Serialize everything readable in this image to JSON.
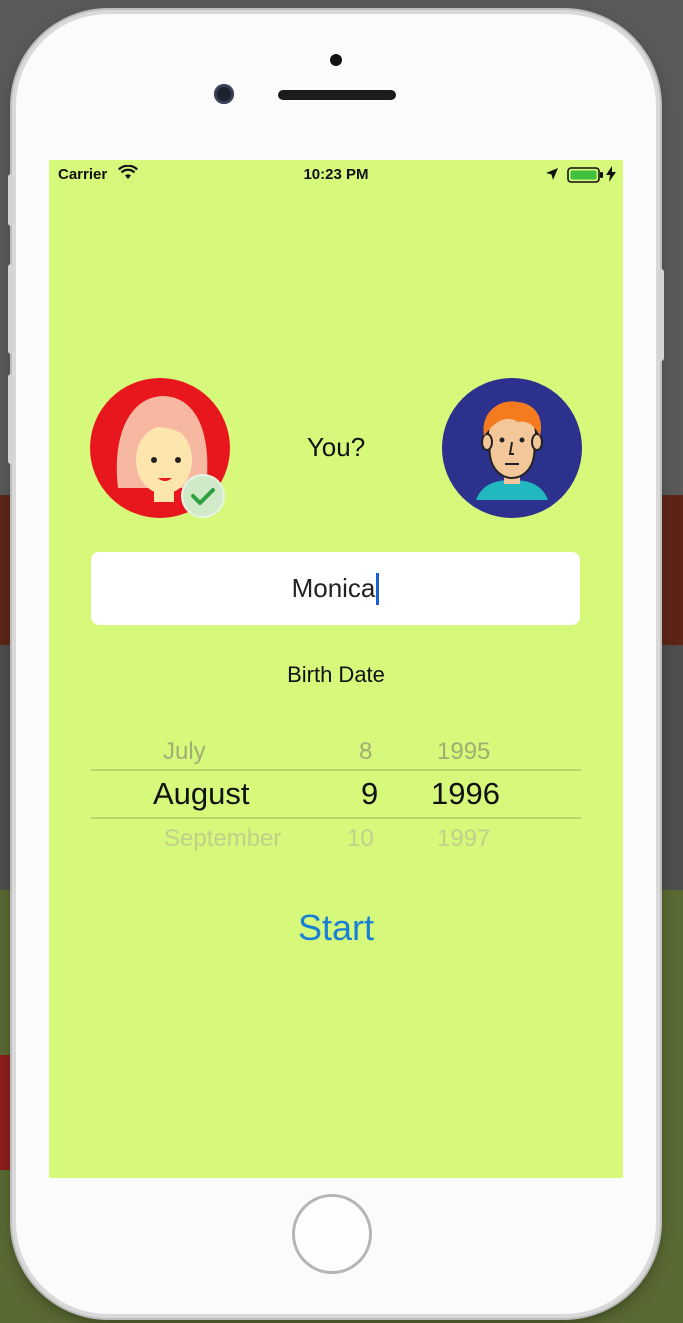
{
  "status_bar": {
    "carrier": "Carrier",
    "time": "10:23 PM"
  },
  "profile": {
    "prompt": "You?",
    "selected_avatar": "female-avatar"
  },
  "name_field": {
    "value": "Monica"
  },
  "birth_date": {
    "label": "Birth Date",
    "months": [
      "July",
      "August",
      "September"
    ],
    "days": [
      "8",
      "9",
      "10"
    ],
    "years": [
      "1995",
      "1996",
      "1997"
    ],
    "selected": {
      "month": "August",
      "day": "9",
      "year": "1996"
    }
  },
  "actions": {
    "start_label": "Start"
  },
  "colors": {
    "screen_background": "#d6f97c",
    "accent": "#1a7fd6",
    "female_avatar_bg": "#e8161d",
    "male_avatar_bg": "#2b318c"
  }
}
